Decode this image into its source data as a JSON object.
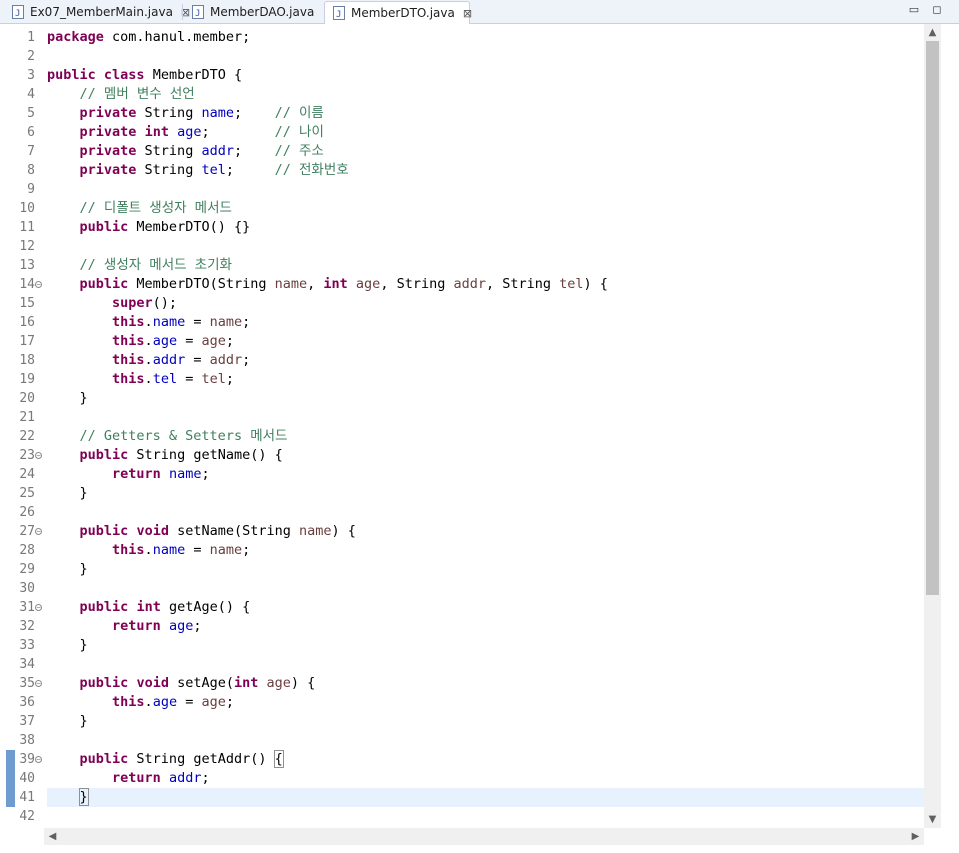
{
  "tabs": [
    {
      "label": "Ex07_MemberMain.java",
      "close": "⊠"
    },
    {
      "label": "MemberDAO.java",
      "close": ""
    },
    {
      "label": "MemberDTO.java",
      "close": "⊠",
      "active": true
    }
  ],
  "window_controls": {
    "minimize": "▭",
    "maximize": "◻"
  },
  "scroll": {
    "up": "▲",
    "down": "▼",
    "left": "◀",
    "right": "▶",
    "vertical_position": 0.0,
    "vertical_visible_fraction": 0.72
  },
  "editor": {
    "current_line": 41,
    "lines": [
      {
        "n": "1",
        "segs": [
          [
            "kw",
            "package"
          ],
          [
            "t",
            " com.hanul.member;"
          ]
        ]
      },
      {
        "n": "2",
        "segs": []
      },
      {
        "n": "3",
        "segs": [
          [
            "kw",
            "public"
          ],
          [
            "t",
            " "
          ],
          [
            "kw",
            "class"
          ],
          [
            "t",
            " MemberDTO {"
          ]
        ]
      },
      {
        "n": "4",
        "segs": [
          [
            "t",
            "    "
          ],
          [
            "cmt",
            "// 멤버 변수 선언"
          ]
        ]
      },
      {
        "n": "5",
        "segs": [
          [
            "t",
            "    "
          ],
          [
            "kw",
            "private"
          ],
          [
            "t",
            " String "
          ],
          [
            "fld",
            "name"
          ],
          [
            "t",
            ";    "
          ],
          [
            "cmt",
            "// 이름"
          ]
        ]
      },
      {
        "n": "6",
        "segs": [
          [
            "t",
            "    "
          ],
          [
            "kw",
            "private"
          ],
          [
            "t",
            " "
          ],
          [
            "kw",
            "int"
          ],
          [
            "t",
            " "
          ],
          [
            "fld",
            "age"
          ],
          [
            "t",
            ";        "
          ],
          [
            "cmt",
            "// 나이"
          ]
        ]
      },
      {
        "n": "7",
        "segs": [
          [
            "t",
            "    "
          ],
          [
            "kw",
            "private"
          ],
          [
            "t",
            " String "
          ],
          [
            "fld",
            "addr"
          ],
          [
            "t",
            ";    "
          ],
          [
            "cmt",
            "// 주소"
          ]
        ]
      },
      {
        "n": "8",
        "segs": [
          [
            "t",
            "    "
          ],
          [
            "kw",
            "private"
          ],
          [
            "t",
            " String "
          ],
          [
            "fld",
            "tel"
          ],
          [
            "t",
            ";     "
          ],
          [
            "cmt",
            "// 전화번호"
          ]
        ]
      },
      {
        "n": "9",
        "segs": []
      },
      {
        "n": "10",
        "segs": [
          [
            "t",
            "    "
          ],
          [
            "cmt",
            "// 디폴트 생성자 메서드"
          ]
        ]
      },
      {
        "n": "11",
        "segs": [
          [
            "t",
            "    "
          ],
          [
            "kw",
            "public"
          ],
          [
            "t",
            " MemberDTO() {}"
          ]
        ]
      },
      {
        "n": "12",
        "segs": []
      },
      {
        "n": "13",
        "segs": [
          [
            "t",
            "    "
          ],
          [
            "cmt",
            "// 생성자 메서드 초기화"
          ]
        ]
      },
      {
        "n": "14",
        "fold": "−",
        "segs": [
          [
            "t",
            "    "
          ],
          [
            "kw",
            "public"
          ],
          [
            "t",
            " MemberDTO(String "
          ],
          [
            "prm",
            "name"
          ],
          [
            "t",
            ", "
          ],
          [
            "kw",
            "int"
          ],
          [
            "t",
            " "
          ],
          [
            "prm",
            "age"
          ],
          [
            "t",
            ", String "
          ],
          [
            "prm",
            "addr"
          ],
          [
            "t",
            ", String "
          ],
          [
            "prm",
            "tel"
          ],
          [
            "t",
            ") {"
          ]
        ]
      },
      {
        "n": "15",
        "segs": [
          [
            "t",
            "        "
          ],
          [
            "kw",
            "super"
          ],
          [
            "t",
            "();"
          ]
        ]
      },
      {
        "n": "16",
        "segs": [
          [
            "t",
            "        "
          ],
          [
            "kw",
            "this"
          ],
          [
            "t",
            "."
          ],
          [
            "fld",
            "name"
          ],
          [
            "t",
            " = "
          ],
          [
            "prm",
            "name"
          ],
          [
            "t",
            ";"
          ]
        ]
      },
      {
        "n": "17",
        "segs": [
          [
            "t",
            "        "
          ],
          [
            "kw",
            "this"
          ],
          [
            "t",
            "."
          ],
          [
            "fld",
            "age"
          ],
          [
            "t",
            " = "
          ],
          [
            "prm",
            "age"
          ],
          [
            "t",
            ";"
          ]
        ]
      },
      {
        "n": "18",
        "segs": [
          [
            "t",
            "        "
          ],
          [
            "kw",
            "this"
          ],
          [
            "t",
            "."
          ],
          [
            "fld",
            "addr"
          ],
          [
            "t",
            " = "
          ],
          [
            "prm",
            "addr"
          ],
          [
            "t",
            ";"
          ]
        ]
      },
      {
        "n": "19",
        "segs": [
          [
            "t",
            "        "
          ],
          [
            "kw",
            "this"
          ],
          [
            "t",
            "."
          ],
          [
            "fld",
            "tel"
          ],
          [
            "t",
            " = "
          ],
          [
            "prm",
            "tel"
          ],
          [
            "t",
            ";"
          ]
        ]
      },
      {
        "n": "20",
        "segs": [
          [
            "t",
            "    }"
          ]
        ]
      },
      {
        "n": "21",
        "segs": []
      },
      {
        "n": "22",
        "segs": [
          [
            "t",
            "    "
          ],
          [
            "cmt",
            "// Getters & Setters 메서드"
          ]
        ]
      },
      {
        "n": "23",
        "fold": "−",
        "segs": [
          [
            "t",
            "    "
          ],
          [
            "kw",
            "public"
          ],
          [
            "t",
            " String getName() {"
          ]
        ]
      },
      {
        "n": "24",
        "segs": [
          [
            "t",
            "        "
          ],
          [
            "kw",
            "return"
          ],
          [
            "t",
            " "
          ],
          [
            "fld",
            "name"
          ],
          [
            "t",
            ";"
          ]
        ]
      },
      {
        "n": "25",
        "segs": [
          [
            "t",
            "    }"
          ]
        ]
      },
      {
        "n": "26",
        "segs": []
      },
      {
        "n": "27",
        "fold": "−",
        "segs": [
          [
            "t",
            "    "
          ],
          [
            "kw",
            "public"
          ],
          [
            "t",
            " "
          ],
          [
            "kw",
            "void"
          ],
          [
            "t",
            " setName(String "
          ],
          [
            "prm",
            "name"
          ],
          [
            "t",
            ") {"
          ]
        ]
      },
      {
        "n": "28",
        "segs": [
          [
            "t",
            "        "
          ],
          [
            "kw",
            "this"
          ],
          [
            "t",
            "."
          ],
          [
            "fld",
            "name"
          ],
          [
            "t",
            " = "
          ],
          [
            "prm",
            "name"
          ],
          [
            "t",
            ";"
          ]
        ]
      },
      {
        "n": "29",
        "segs": [
          [
            "t",
            "    }"
          ]
        ]
      },
      {
        "n": "30",
        "segs": []
      },
      {
        "n": "31",
        "fold": "−",
        "segs": [
          [
            "t",
            "    "
          ],
          [
            "kw",
            "public"
          ],
          [
            "t",
            " "
          ],
          [
            "kw",
            "int"
          ],
          [
            "t",
            " getAge() {"
          ]
        ]
      },
      {
        "n": "32",
        "segs": [
          [
            "t",
            "        "
          ],
          [
            "kw",
            "return"
          ],
          [
            "t",
            " "
          ],
          [
            "fld",
            "age"
          ],
          [
            "t",
            ";"
          ]
        ]
      },
      {
        "n": "33",
        "segs": [
          [
            "t",
            "    }"
          ]
        ]
      },
      {
        "n": "34",
        "segs": []
      },
      {
        "n": "35",
        "fold": "−",
        "segs": [
          [
            "t",
            "    "
          ],
          [
            "kw",
            "public"
          ],
          [
            "t",
            " "
          ],
          [
            "kw",
            "void"
          ],
          [
            "t",
            " setAge("
          ],
          [
            "kw",
            "int"
          ],
          [
            "t",
            " "
          ],
          [
            "prm",
            "age"
          ],
          [
            "t",
            ") {"
          ]
        ]
      },
      {
        "n": "36",
        "segs": [
          [
            "t",
            "        "
          ],
          [
            "kw",
            "this"
          ],
          [
            "t",
            "."
          ],
          [
            "fld",
            "age"
          ],
          [
            "t",
            " = "
          ],
          [
            "prm",
            "age"
          ],
          [
            "t",
            ";"
          ]
        ]
      },
      {
        "n": "37",
        "segs": [
          [
            "t",
            "    }"
          ]
        ]
      },
      {
        "n": "38",
        "segs": []
      },
      {
        "n": "39",
        "fold": "−",
        "mark": true,
        "segs": [
          [
            "t",
            "    "
          ],
          [
            "kw",
            "public"
          ],
          [
            "t",
            " String getAddr() "
          ],
          [
            "bm",
            "{"
          ]
        ]
      },
      {
        "n": "40",
        "mark": true,
        "segs": [
          [
            "t",
            "        "
          ],
          [
            "kw",
            "return"
          ],
          [
            "t",
            " "
          ],
          [
            "fld",
            "addr"
          ],
          [
            "t",
            ";"
          ]
        ]
      },
      {
        "n": "41",
        "mark": true,
        "caret": true,
        "segs": [
          [
            "t",
            "    "
          ],
          [
            "bm",
            "}"
          ]
        ]
      },
      {
        "n": "42",
        "segs": []
      }
    ]
  }
}
